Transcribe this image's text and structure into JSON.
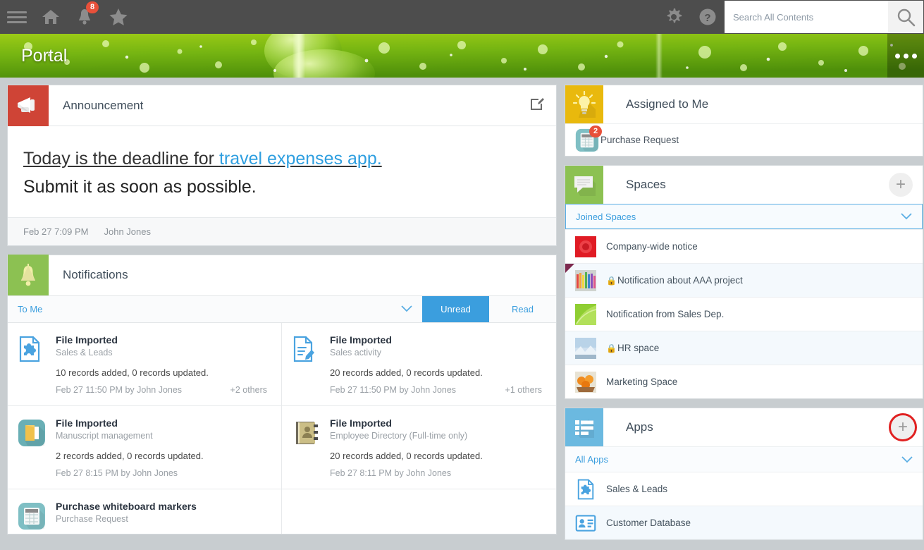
{
  "topbar": {
    "menu_icon": "hamburger-icon",
    "home_icon": "home-icon",
    "bell_icon": "bell-icon",
    "bell_badge": "8",
    "star_icon": "star-icon",
    "gear_icon": "gear-icon",
    "help_icon": "help-icon",
    "search_placeholder": "Search All Contents",
    "search_value": "",
    "search_icon": "search-icon"
  },
  "banner": {
    "title": "Portal",
    "overflow_icon": "more-options-icon"
  },
  "announcement": {
    "icon": "megaphone-icon",
    "title": "Announcement",
    "edit_icon": "edit-icon",
    "body_line1_a": "Today is the deadline for ",
    "body_line1_link": "travel expenses app.",
    "body_line2": "Submit it as soon as possible.",
    "timestamp": "Feb 27 7:09 PM",
    "author": "John Jones"
  },
  "notifications": {
    "icon": "bell-icon",
    "title": "Notifications",
    "filter_label": "To Me",
    "filter_chevron": "chevron-down-icon",
    "tab_unread": "Unread",
    "tab_read": "Read",
    "active_tab": "Unread",
    "items": [
      {
        "icon": "document-puzzle-icon",
        "title": "File Imported",
        "subtitle": "Sales & Leads",
        "description": "10 records added, 0 records updated.",
        "meta": "Feb 27 11:50 PM  by John Jones",
        "others": "+2 others"
      },
      {
        "icon": "document-pencil-icon",
        "title": "File Imported",
        "subtitle": "Sales activity",
        "description": "20 records added, 0 records updated.",
        "meta": "Feb 27 11:50 PM  by John Jones",
        "others": "+1 others"
      },
      {
        "icon": "folder-icon",
        "title": "File Imported",
        "subtitle": "Manuscript management",
        "description": "2 records added, 0 records updated.",
        "meta": "Feb 27 8:15 PM  by John Jones",
        "others": ""
      },
      {
        "icon": "address-book-icon",
        "title": "File Imported",
        "subtitle": "Employee Directory (Full-time only)",
        "description": "20 records added, 0 records updated.",
        "meta": "Feb 27 8:11 PM  by John Jones",
        "others": ""
      },
      {
        "icon": "calculator-icon",
        "title": "Purchase whiteboard markers",
        "subtitle": "Purchase Request",
        "description": "",
        "meta": "",
        "others": ""
      }
    ]
  },
  "assigned": {
    "icon": "lightbulb-icon",
    "title": "Assigned to Me",
    "items": [
      {
        "icon": "calculator-icon",
        "badge": "2",
        "label": "Purchase Request"
      }
    ]
  },
  "spaces": {
    "icon": "speech-bubble-icon",
    "title": "Spaces",
    "add_icon": "plus-icon",
    "filter_label": "Joined Spaces",
    "filter_chevron": "chevron-down-icon",
    "items": [
      {
        "thumb": "red-rose-thumb",
        "label": "Company-wide notice",
        "locked": false,
        "flagged": false
      },
      {
        "thumb": "pencils-thumb",
        "label": "Notification about AAA project",
        "locked": true,
        "flagged": true
      },
      {
        "thumb": "green-leaf-thumb",
        "label": "Notification from Sales Dep.",
        "locked": false,
        "flagged": false
      },
      {
        "thumb": "winter-landscape-thumb",
        "label": "HR space",
        "locked": true,
        "flagged": false
      },
      {
        "thumb": "oranges-thumb",
        "label": "Marketing Space",
        "locked": false,
        "flagged": false
      }
    ]
  },
  "apps": {
    "icon": "list-icon",
    "title": "Apps",
    "add_icon": "plus-icon",
    "filter_label": "All Apps",
    "filter_chevron": "chevron-down-icon",
    "items": [
      {
        "icon": "document-puzzle-icon",
        "label": "Sales & Leads"
      },
      {
        "icon": "id-card-icon",
        "label": "Customer Database"
      }
    ]
  },
  "colors": {
    "topbar": "#4d4d4d",
    "accent_blue": "#3b9ede",
    "badge_red": "#e8503a",
    "highlight_red": "#e02020",
    "announcement_tile": "#cf4436",
    "notifications_tile": "#8cc152",
    "assigned_tile": "#e9b90d",
    "spaces_tile": "#8cc152",
    "apps_tile": "#6bb9e0"
  }
}
